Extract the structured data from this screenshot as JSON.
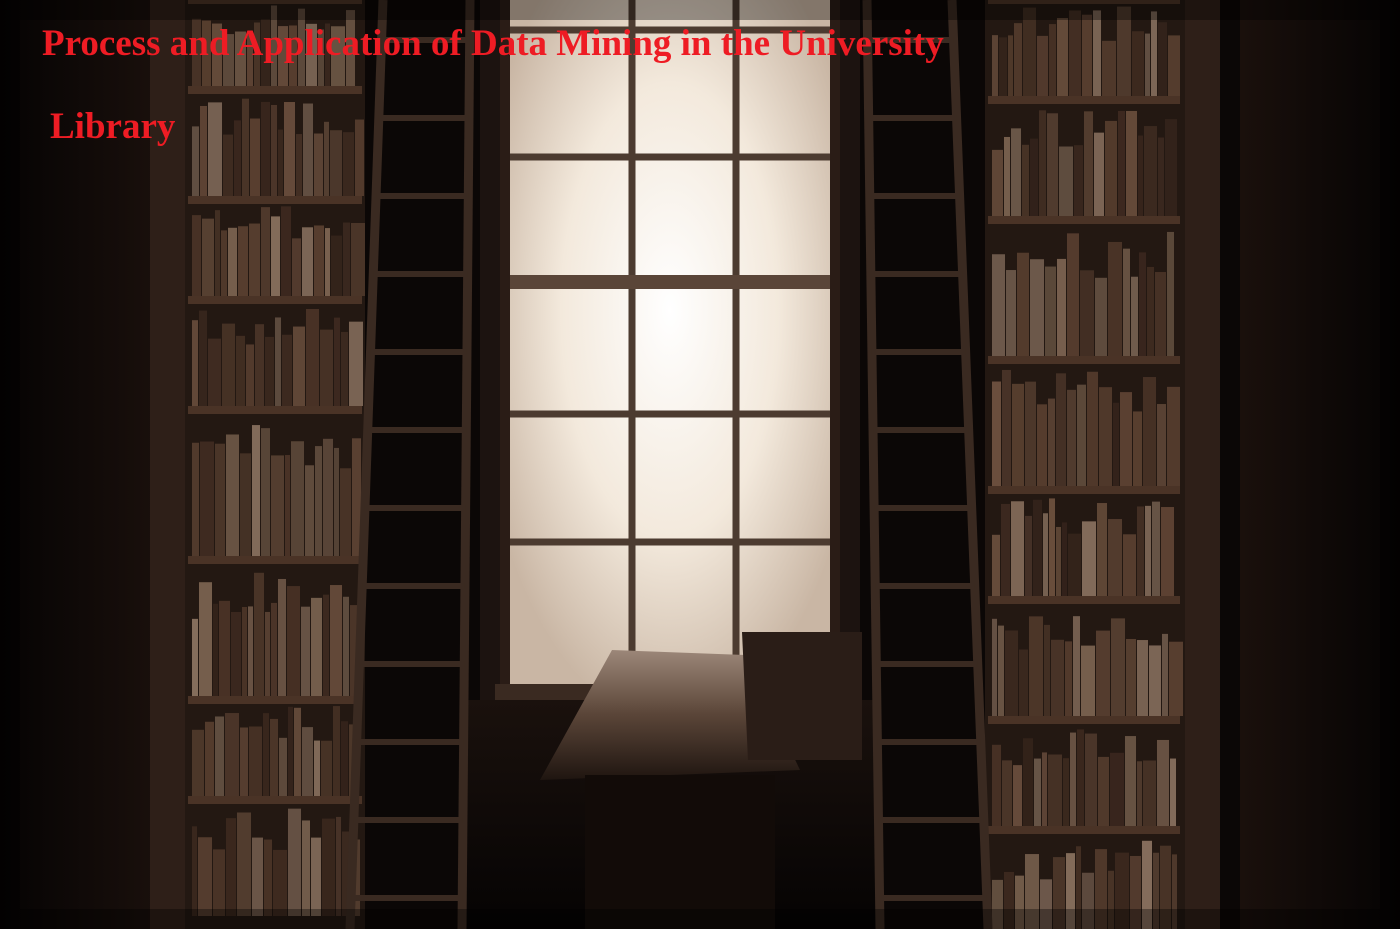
{
  "title": {
    "line1": "Process and Application of Data Mining in the University",
    "line2": "Library"
  },
  "colors": {
    "title_red": "#ee1c24",
    "background": "#0b0706",
    "window_light": "#f6efe4",
    "shelf_wood": "#4a3326"
  }
}
